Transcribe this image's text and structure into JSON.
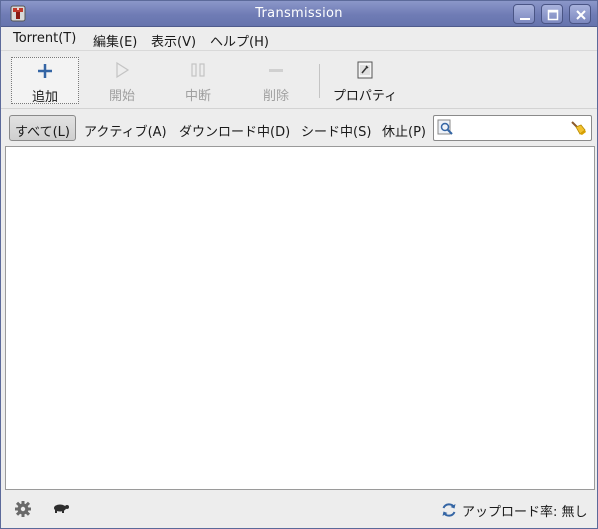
{
  "window": {
    "title": "Transmission"
  },
  "menu": {
    "items": [
      "Torrent(T)",
      "編集(E)",
      "表示(V)",
      "ヘルプ(H)"
    ]
  },
  "toolbar": {
    "add_label": "追加",
    "start_label": "開始",
    "pause_label": "中断",
    "remove_label": "削除",
    "properties_label": "プロパティ"
  },
  "filters": {
    "items": [
      "すべて(L)",
      "アクティブ(A)",
      "ダウンロード中(D)",
      "シード中(S)",
      "休止(P)"
    ],
    "selected": "すべて(L)"
  },
  "search": {
    "value": "",
    "placeholder": ""
  },
  "status": {
    "upload_rate": "アップロード率: 無し"
  },
  "icons": {
    "app": "transmission-app-icon",
    "add": "plus-icon",
    "start": "play-icon",
    "pause": "pause-icon",
    "remove": "minus-icon",
    "properties": "properties-icon",
    "search": "search-icon",
    "clear": "clear-broom-icon",
    "preferences": "gear-icon",
    "speed_limit": "turtle-icon",
    "ratio": "refresh-icon"
  },
  "colors": {
    "titlebar": "#6f7cb5",
    "accent_blue": "#3465a4"
  }
}
